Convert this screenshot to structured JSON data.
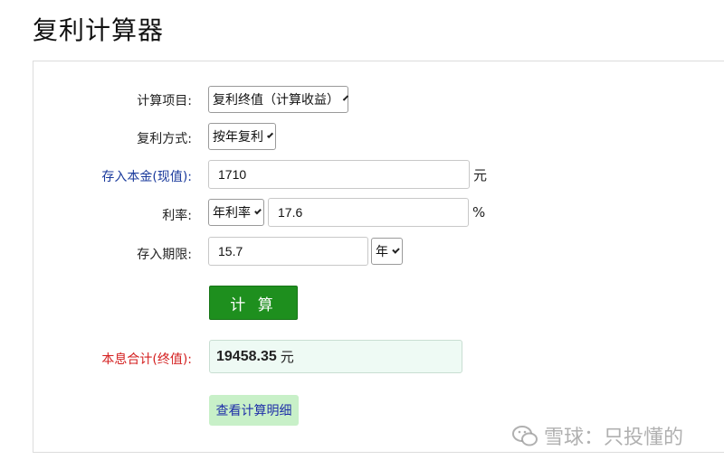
{
  "page": {
    "title": "复利计算器"
  },
  "form": {
    "project_label": "计算项目:",
    "project_value": "复利终值（计算收益）",
    "method_label": "复利方式:",
    "method_value": "按年复利",
    "principal_label": "存入本金(现值):",
    "principal_value": "1710",
    "principal_unit": "元",
    "rate_label": "利率:",
    "rate_type_value": "年利率",
    "rate_value": "17.6",
    "rate_unit": "%",
    "term_label": "存入期限:",
    "term_value": "15.7",
    "term_unit_value": "年"
  },
  "actions": {
    "calculate_label": "计 算",
    "detail_label": "查看计算明细"
  },
  "result": {
    "label": "本息合计(终值):",
    "value": "19458.35",
    "unit": "元"
  },
  "watermark": {
    "text": "雪球：只投懂的"
  },
  "colors": {
    "calc_button": "#1e8f1e",
    "detail_button_bg": "#c8f0c8",
    "result_bg": "#eefaf4",
    "label_blue": "#1a3a9c",
    "label_red": "#d42020"
  }
}
